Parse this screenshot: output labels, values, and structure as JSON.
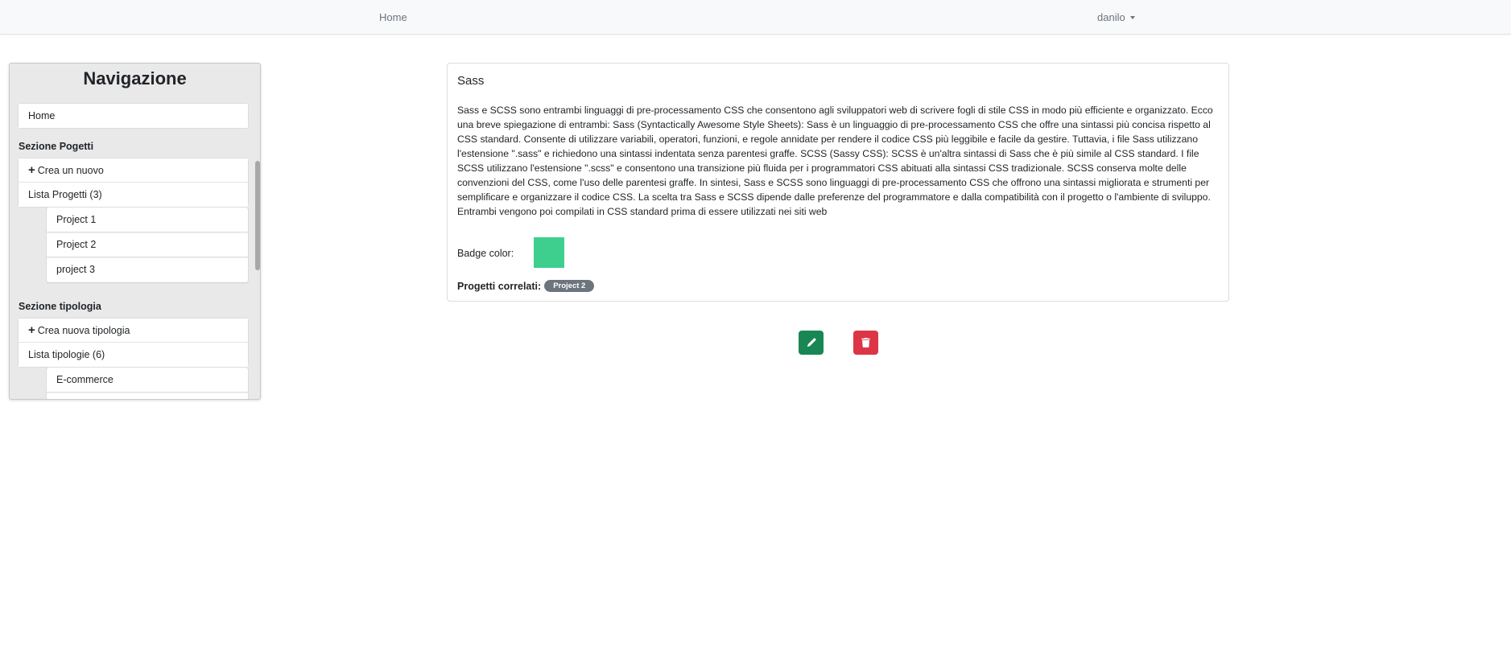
{
  "navbar": {
    "home_label": "Home",
    "user_label": "danilo"
  },
  "sidebar": {
    "title": "Navigazione",
    "home_item": "Home",
    "projects_section": {
      "heading": "Sezione Pogetti",
      "create_label": "Crea un nuovo",
      "list_label": "Lista Progetti (3)",
      "projects": [
        "Project 1",
        "Project 2",
        "project 3"
      ]
    },
    "types_section": {
      "heading": "Sezione tipologia",
      "create_label": "Crea nuova tipologia",
      "list_label": "Lista tipologie (6)",
      "types": [
        "E-commerce",
        ""
      ]
    }
  },
  "card": {
    "title": "Sass",
    "description": "Sass e SCSS sono entrambi linguaggi di pre-processamento CSS che consentono agli sviluppatori web di scrivere fogli di stile CSS in modo più efficiente e organizzato. Ecco una breve spiegazione di entrambi: Sass (Syntactically Awesome Style Sheets): Sass è un linguaggio di pre-processamento CSS che offre una sintassi più concisa rispetto al CSS standard. Consente di utilizzare variabili, operatori, funzioni, e regole annidate per rendere il codice CSS più leggibile e facile da gestire. Tuttavia, i file Sass utilizzano l'estensione \".sass\" e richiedono una sintassi indentata senza parentesi graffe. SCSS (Sassy CSS): SCSS è un'altra sintassi di Sass che è più simile al CSS standard. I file SCSS utilizzano l'estensione \".scss\" e consentono una transizione più fluida per i programmatori CSS abituati alla sintassi CSS tradizionale. SCSS conserva molte delle convenzioni del CSS, come l'uso delle parentesi graffe. In sintesi, Sass e SCSS sono linguaggi di pre-processamento CSS che offrono una sintassi migliorata e strumenti per semplificare e organizzare il codice CSS. La scelta tra Sass e SCSS dipende dalle preferenze del programmatore e dalla compatibilità con il progetto o l'ambiente di sviluppo. Entrambi vengono poi compilati in CSS standard prima di essere utilizzati nei siti web",
    "badge_color_label": "Badge color:",
    "badge_color": "#3ecf8e",
    "related_label": "Progetti correlati:",
    "related_projects": [
      "Project 2"
    ],
    "pill_color": "#6c757d"
  },
  "actions": {
    "edit_icon": "pencil-icon",
    "edit_color": "#198754",
    "delete_icon": "trash-icon",
    "delete_color": "#dc3545"
  }
}
